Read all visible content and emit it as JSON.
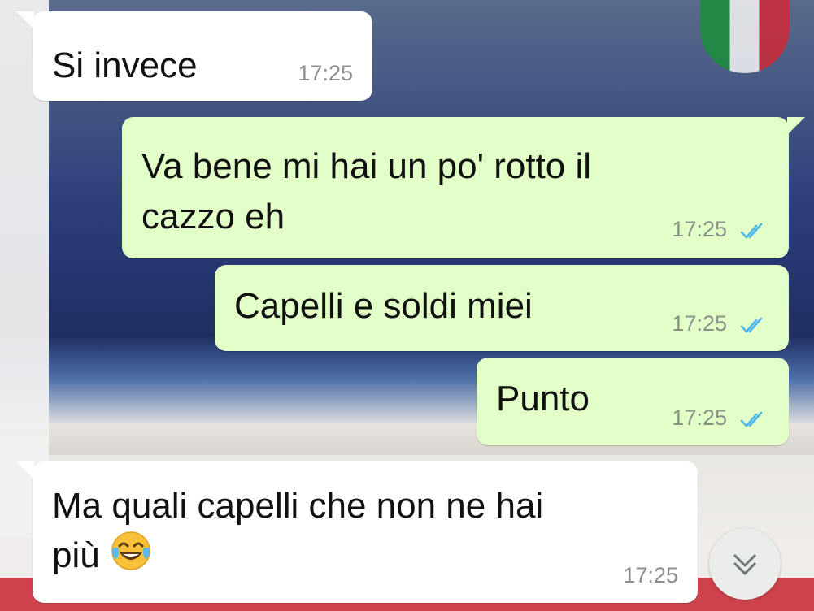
{
  "messages": [
    {
      "direction": "incoming",
      "lines": [
        "Si invece"
      ],
      "time": "17:25"
    },
    {
      "direction": "outgoing",
      "lines": [
        "Va bene mi hai un po' rotto il",
        "cazzo eh"
      ],
      "time": "17:25",
      "status": "read"
    },
    {
      "direction": "outgoing",
      "lines": [
        "Capelli e soldi miei"
      ],
      "time": "17:25",
      "status": "read"
    },
    {
      "direction": "outgoing",
      "lines": [
        "Punto"
      ],
      "time": "17:25",
      "status": "read"
    },
    {
      "direction": "incoming",
      "lines": [
        "Ma quali capelli che non ne hai",
        "più"
      ],
      "emoji": "face-with-tears-of-joy",
      "time": "17:25"
    }
  ],
  "colors": {
    "incoming_bubble": "#ffffff",
    "outgoing_bubble": "#e2ffc8",
    "read_tick": "#4fb6ec",
    "timestamp": "#8a9188"
  },
  "icons": {
    "read_receipt": "double-check-icon",
    "scroll_down": "double-chevron-down-icon"
  }
}
